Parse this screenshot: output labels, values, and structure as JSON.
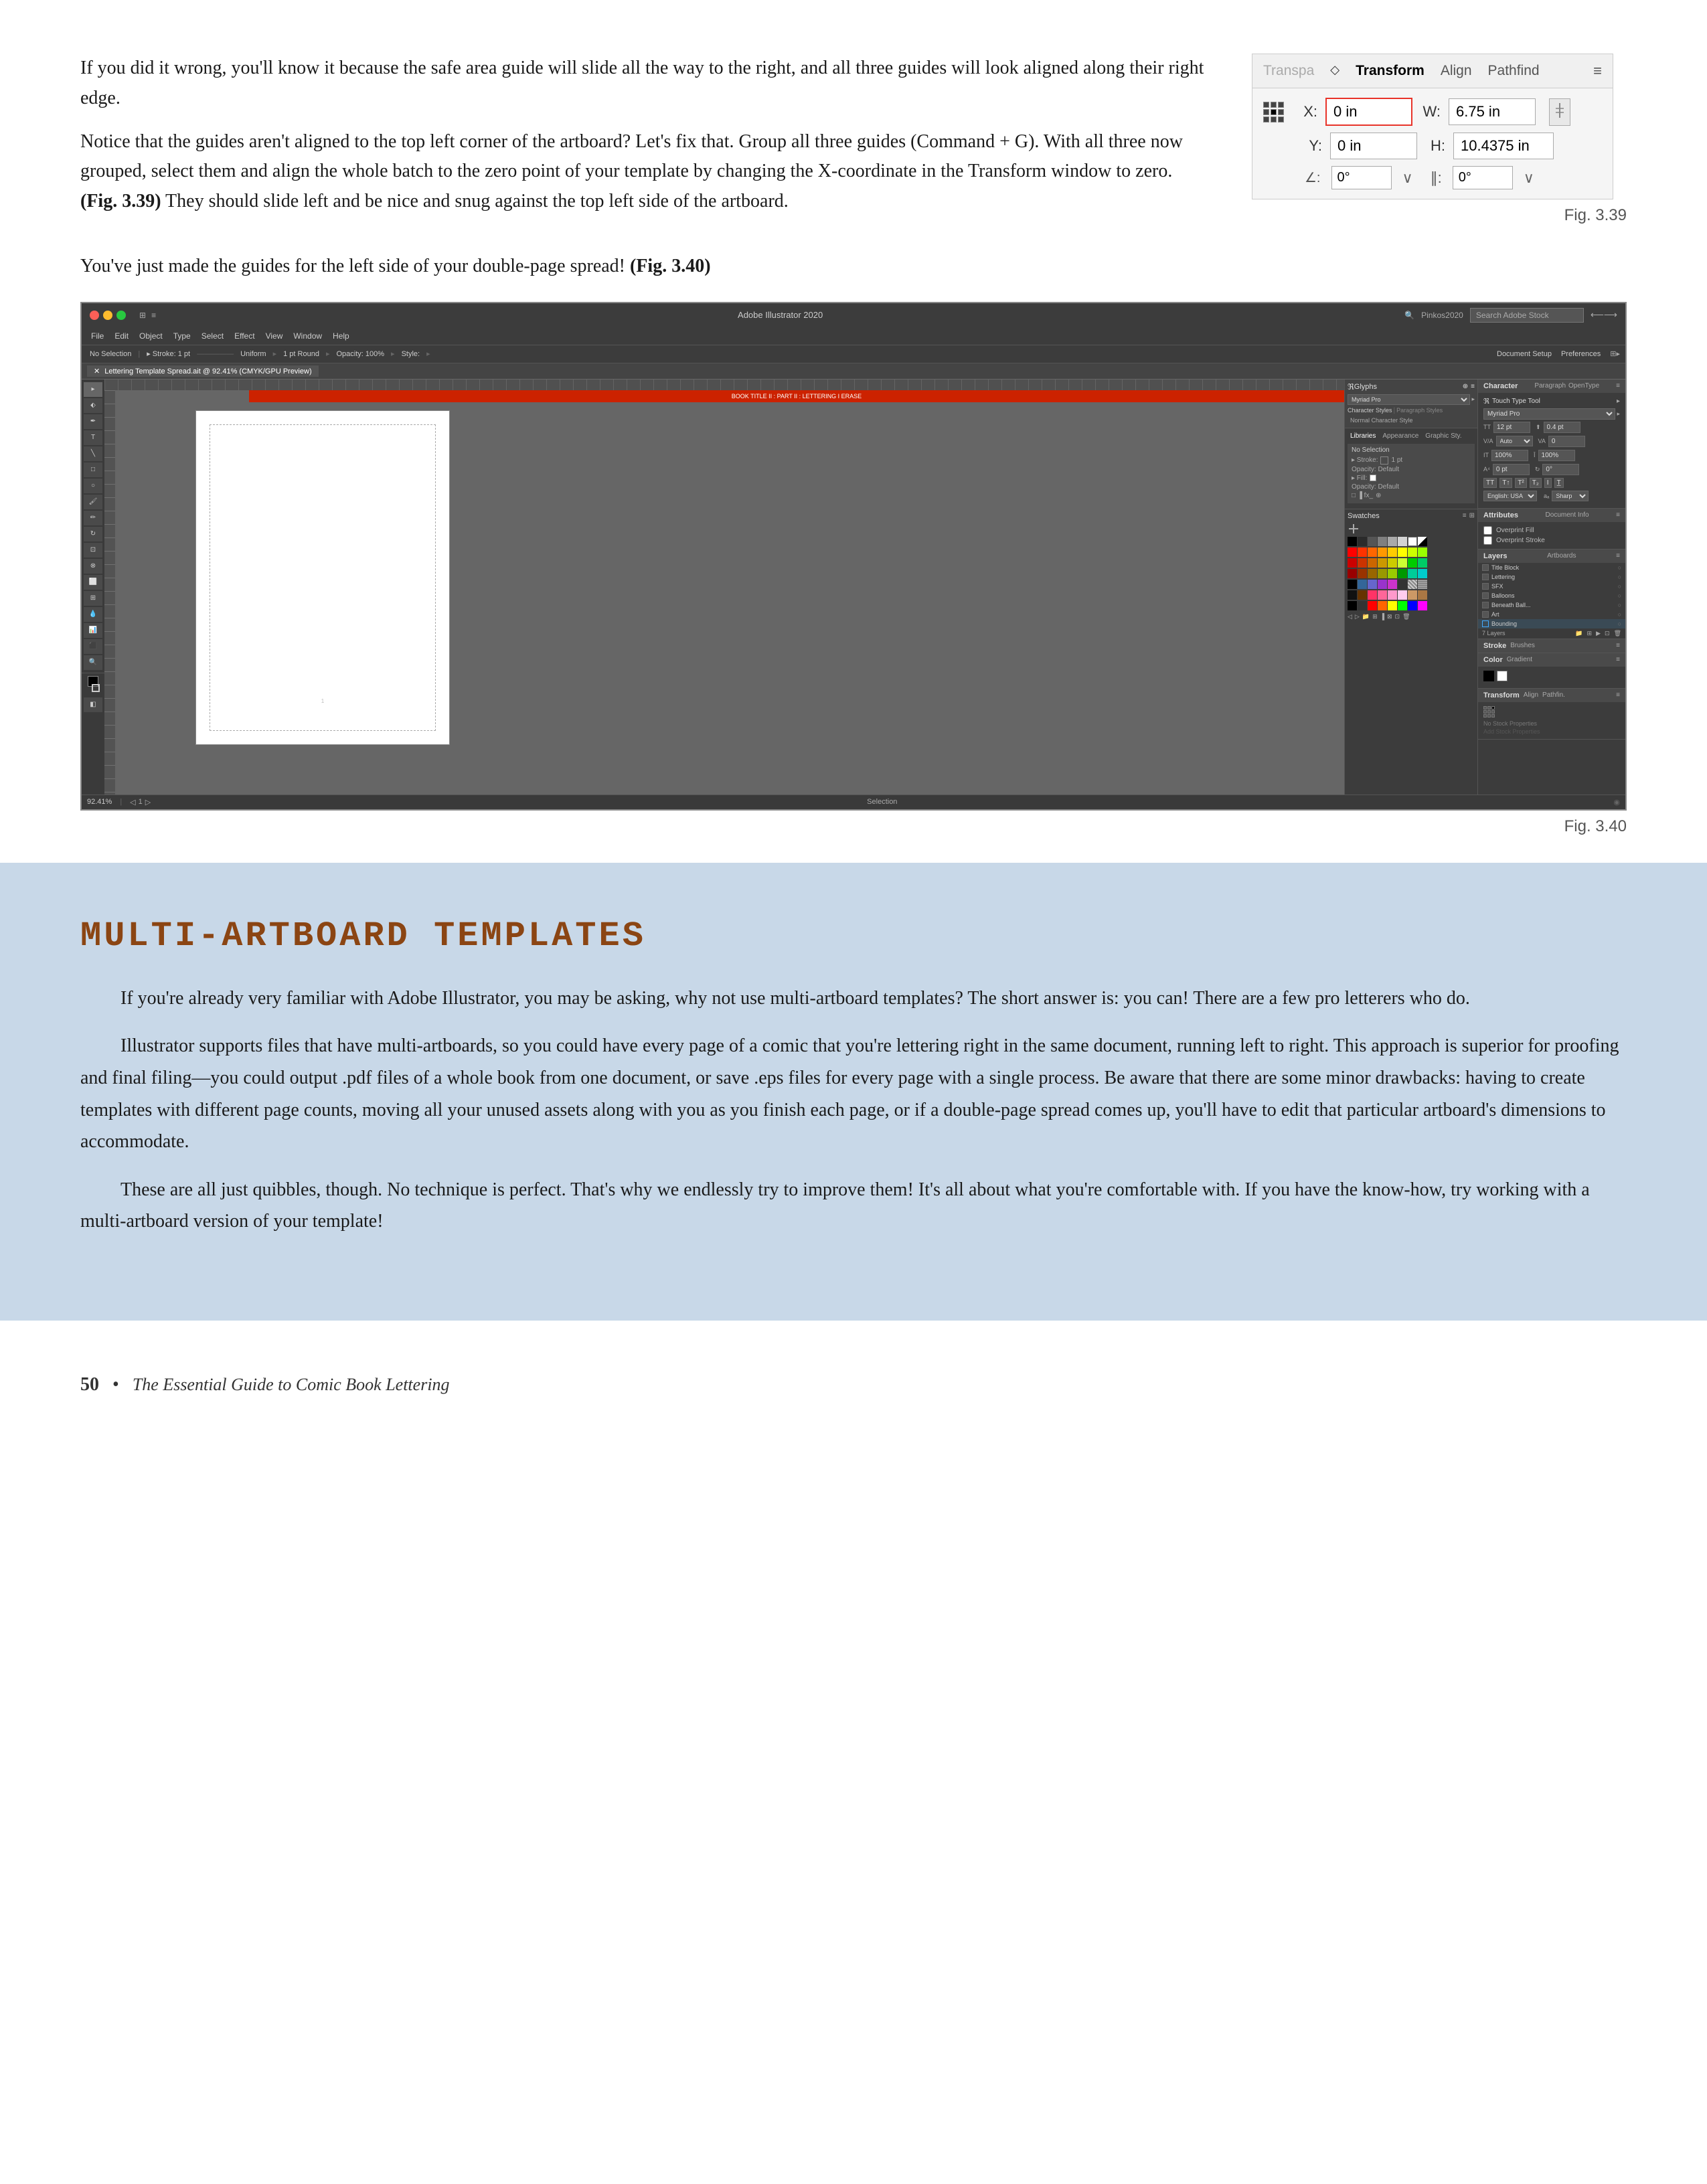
{
  "page": {
    "number": "50",
    "footer_bullet": "•",
    "footer_title": "The Essential Guide to Comic Book Lettering"
  },
  "top_section": {
    "paragraph1": "If you did it wrong, you'll know it because the safe area guide will slide all the way to the right, and all three guides will look aligned along their right edge.",
    "paragraph2_start": "Notice that the guides aren't aligned to the top left corner of the artboard? Let's fix that. Group all three guides (Command + G). With all three now grouped, select them and align the whole batch to the zero point of your template by changing the X-coordinate in the Transform window to zero.",
    "paragraph2_bold": "(Fig. 3.39)",
    "paragraph2_end": " They should slide left and be nice and snug against the top left side of the artboard.",
    "paragraph3_start": "You've just made the guides for the left side of your double-page spread!",
    "paragraph3_bold": "(Fig. 3.40)"
  },
  "transform_panel": {
    "title": "Transform",
    "diamond": "◇",
    "tab_transpas": "Transpa",
    "tab_transform": "Transform",
    "tab_align": "Align",
    "tab_pathfind": "Pathfind",
    "menu_icon": "≡",
    "x_label": "X:",
    "x_value": "0 in",
    "w_label": "W:",
    "w_value": "6.75 in",
    "y_label": "Y:",
    "y_value": "0 in",
    "h_label": "H:",
    "h_value": "10.4375 in",
    "angle1_label": "∠:",
    "angle1_value": "0°",
    "angle2_label": "∥:",
    "angle2_value": "0°",
    "fig_label": "Fig. 3.39"
  },
  "fig340": {
    "label": "Fig. 3.40"
  },
  "ai_window": {
    "title": "Adobe Illustrator 2020",
    "username": "Pinkos2020",
    "search_placeholder": "Search Adobe Stock",
    "tab_name": "Lettering Template Spread.ait @ 92.41% (CMYK/GPU Preview)",
    "no_selection": "No Selection",
    "file_info": "92.41%",
    "selection_label": "Selection"
  },
  "ai_panels": {
    "character_label": "Character",
    "paragraph_label": "Paragraph",
    "opentype_label": "OpenType",
    "glyphs_label": "Glyphs",
    "font_name": "Myriad Pro",
    "char_styles_label": "Character Styles",
    "para_styles_label": "Paragraph Styles",
    "normal_style": "Normal Character Style",
    "touch_type": "Touch Type Tool",
    "font_size": "12 pt",
    "leading": "0.4 pt",
    "tracking": "Auto",
    "kerning": "0",
    "scale_h": "100%",
    "scale_v": "100%",
    "baseline": "0 pt",
    "language": "English: USA",
    "sharp": "Sharp",
    "layers_label": "Layers",
    "artboards_label": "Artboards",
    "layers": [
      "Title Block",
      "Lettering",
      "SFX",
      "Balloons",
      "Beneath Ball...",
      "Art",
      "Bounding"
    ],
    "artboards_count": "7 Layers",
    "libraries_label": "Libraries",
    "appearance_label": "Appearance",
    "graphic_styles_label": "Graphic Sty.",
    "no_selection_panel": "No Selection",
    "stroke_label": "Stroke",
    "stroke_value": "1 pt",
    "fill_label": "Fill",
    "opacity_label": "Opacity: Default",
    "swatches_label": "Swatches",
    "stroke_tab": "Stroke",
    "brushes_tab": "Brushes",
    "color_tab": "Color",
    "gradient_tab": "Gradient",
    "transform_tab": "Transform",
    "align_tab": "Align",
    "pathfinder_tab": "Pathfin."
  },
  "blue_section": {
    "title": "Multi-Artboard Templates",
    "paragraph1": "If you're already very familiar with Adobe Illustrator, you may be asking, why not use multi-artboard templates? The short answer is: you can! There are a few pro letterers who do.",
    "paragraph2": "Illustrator supports files that have multi-artboards, so you could have every page of a comic that you're lettering right in the same document, running left to right. This approach is superior for proofing and final filing—you could output .pdf files of a whole book from one document, or save .eps files for every page with a single process. Be aware that there are some minor drawbacks: having to create templates with different page counts, moving all your unused assets along with you as you finish each page, or if a double-page spread comes up, you'll have to edit that particular artboard's dimensions to accommodate.",
    "paragraph3": "These are all just quibbles, though. No technique is perfect. That's why we endlessly try to improve them! It's all about what you're comfortable with. If you have the know-how, try working with a multi-artboard version of your template!"
  },
  "swatches": {
    "colors": [
      "#000000",
      "#2b2b2b",
      "#555555",
      "#808080",
      "#aaaaaa",
      "#d4d4d4",
      "#ffffff",
      "#ff0000",
      "#ff6600",
      "#ffcc00",
      "#ff0000",
      "#cc0000",
      "#990000",
      "#ff9900",
      "#ff6600",
      "#cc3300",
      "#ffff00",
      "#cccc00",
      "#999900",
      "#00ff00",
      "#00cc00",
      "#009900",
      "#00ffcc",
      "#00ccaa",
      "#009988",
      "#0000ff",
      "#0000cc",
      "#000099",
      "#9900ff",
      "#6600cc",
      "#330099",
      "#ff00ff",
      "#cc00cc",
      "#990099",
      "#ff6699",
      "#cc3366",
      "#991133",
      "#663300",
      "#884411",
      "#aa6622",
      "#ffccaa",
      "#ffaa77",
      "#ff8844",
      "#333300",
      "#666600",
      "#888822"
    ]
  }
}
